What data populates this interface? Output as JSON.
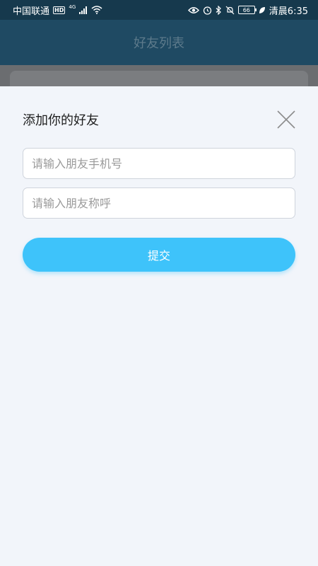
{
  "status_bar": {
    "carrier": "中国联通",
    "hd_badge": "HD",
    "network_type": "4G",
    "battery_level": "66",
    "time": "清晨6:35",
    "icons": [
      "signal-icon",
      "wifi-icon",
      "eye-icon",
      "alarm-icon",
      "bluetooth-icon",
      "mute-icon",
      "battery-icon",
      "leaf-icon"
    ]
  },
  "header": {
    "title": "好友列表"
  },
  "dialog": {
    "title": "添加你的好友",
    "phone_placeholder": "请输入朋友手机号",
    "name_placeholder": "请输入朋友称呼",
    "submit_label": "提交"
  },
  "colors": {
    "status_bar_bg": "#16394d",
    "header_bg": "#1f4a63",
    "sheet_bg": "#f2f5fa",
    "accent": "#3ec3fa"
  }
}
